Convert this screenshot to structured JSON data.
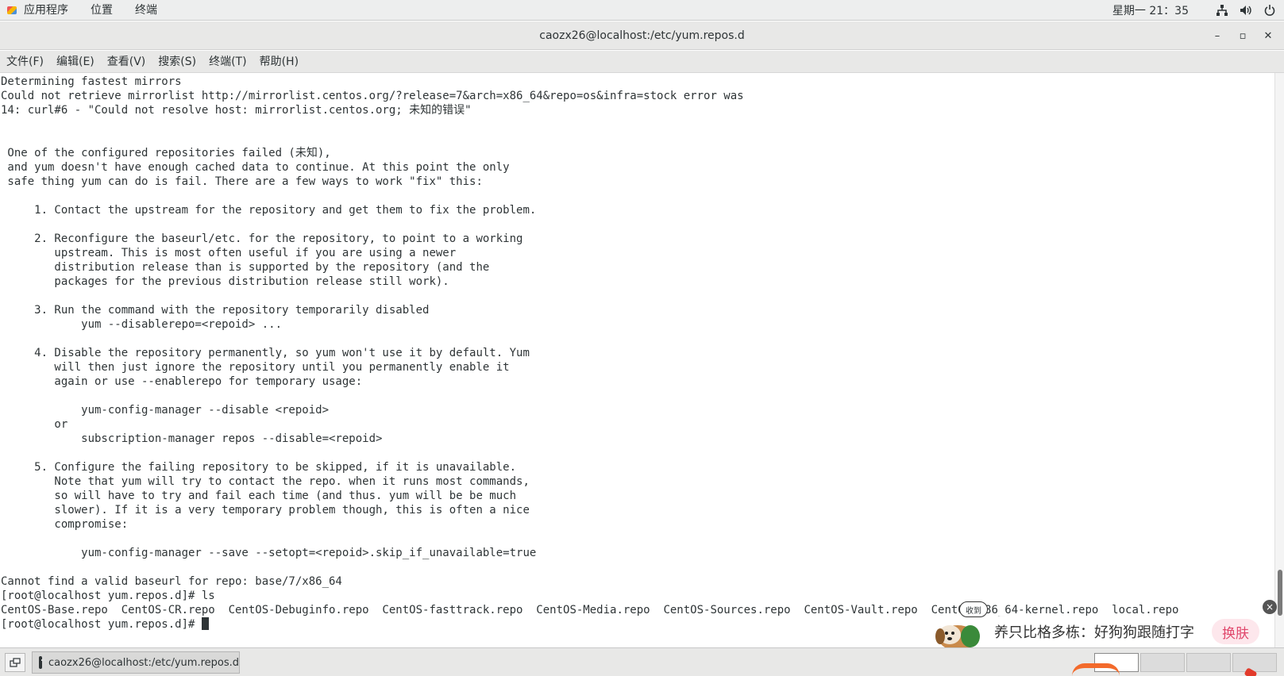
{
  "topbar": {
    "menu": [
      "应用程序",
      "位置",
      "终端"
    ],
    "clock": "星期一 21：35",
    "icons": [
      "network-icon",
      "volume-icon",
      "power-icon"
    ]
  },
  "window": {
    "title": "caozx26@localhost:/etc/yum.repos.d",
    "controls": {
      "minimize": "–",
      "maximize": "▫",
      "close": "✕"
    }
  },
  "menubar": [
    "文件(F)",
    "编辑(E)",
    "查看(V)",
    "搜索(S)",
    "终端(T)",
    "帮助(H)"
  ],
  "terminal": {
    "lines": [
      "Determining fastest mirrors",
      "Could not retrieve mirrorlist http://mirrorlist.centos.org/?release=7&arch=x86_64&repo=os&infra=stock error was",
      "14: curl#6 - \"Could not resolve host: mirrorlist.centos.org; 未知的错误\"",
      "",
      "",
      " One of the configured repositories failed (未知),",
      " and yum doesn't have enough cached data to continue. At this point the only",
      " safe thing yum can do is fail. There are a few ways to work \"fix\" this:",
      "",
      "     1. Contact the upstream for the repository and get them to fix the problem.",
      "",
      "     2. Reconfigure the baseurl/etc. for the repository, to point to a working",
      "        upstream. This is most often useful if you are using a newer",
      "        distribution release than is supported by the repository (and the",
      "        packages for the previous distribution release still work).",
      "",
      "     3. Run the command with the repository temporarily disabled",
      "            yum --disablerepo=<repoid> ...",
      "",
      "     4. Disable the repository permanently, so yum won't use it by default. Yum",
      "        will then just ignore the repository until you permanently enable it",
      "        again or use --enablerepo for temporary usage:",
      "",
      "            yum-config-manager --disable <repoid>",
      "        or",
      "            subscription-manager repos --disable=<repoid>",
      "",
      "     5. Configure the failing repository to be skipped, if it is unavailable.",
      "        Note that yum will try to contact the repo. when it runs most commands,",
      "        so will have to try and fail each time (and thus. yum will be be much",
      "        slower). If it is a very temporary problem though, this is often a nice",
      "        compromise:",
      "",
      "            yum-config-manager --save --setopt=<repoid>.skip_if_unavailable=true",
      "",
      "Cannot find a valid baseurl for repo: base/7/x86_64",
      "[root@localhost yum.repos.d]# ls",
      "CentOS-Base.repo  CentOS-CR.repo  CentOS-Debuginfo.repo  CentOS-fasttrack.repo  CentOS-Media.repo  CentOS-Sources.repo  CentOS-Vault.repo  CentOS-x86_64-kernel.repo  local.repo"
    ],
    "prompt": "[root@localhost yum.repos.d]# "
  },
  "taskbar": {
    "task_label": "caozx26@localhost:/etc/yum.repos.d",
    "workspaces": 4
  },
  "ime_popup": {
    "badge": "收到",
    "text": "养只比格多栋：好狗狗跟随打字",
    "button": "换肤"
  }
}
